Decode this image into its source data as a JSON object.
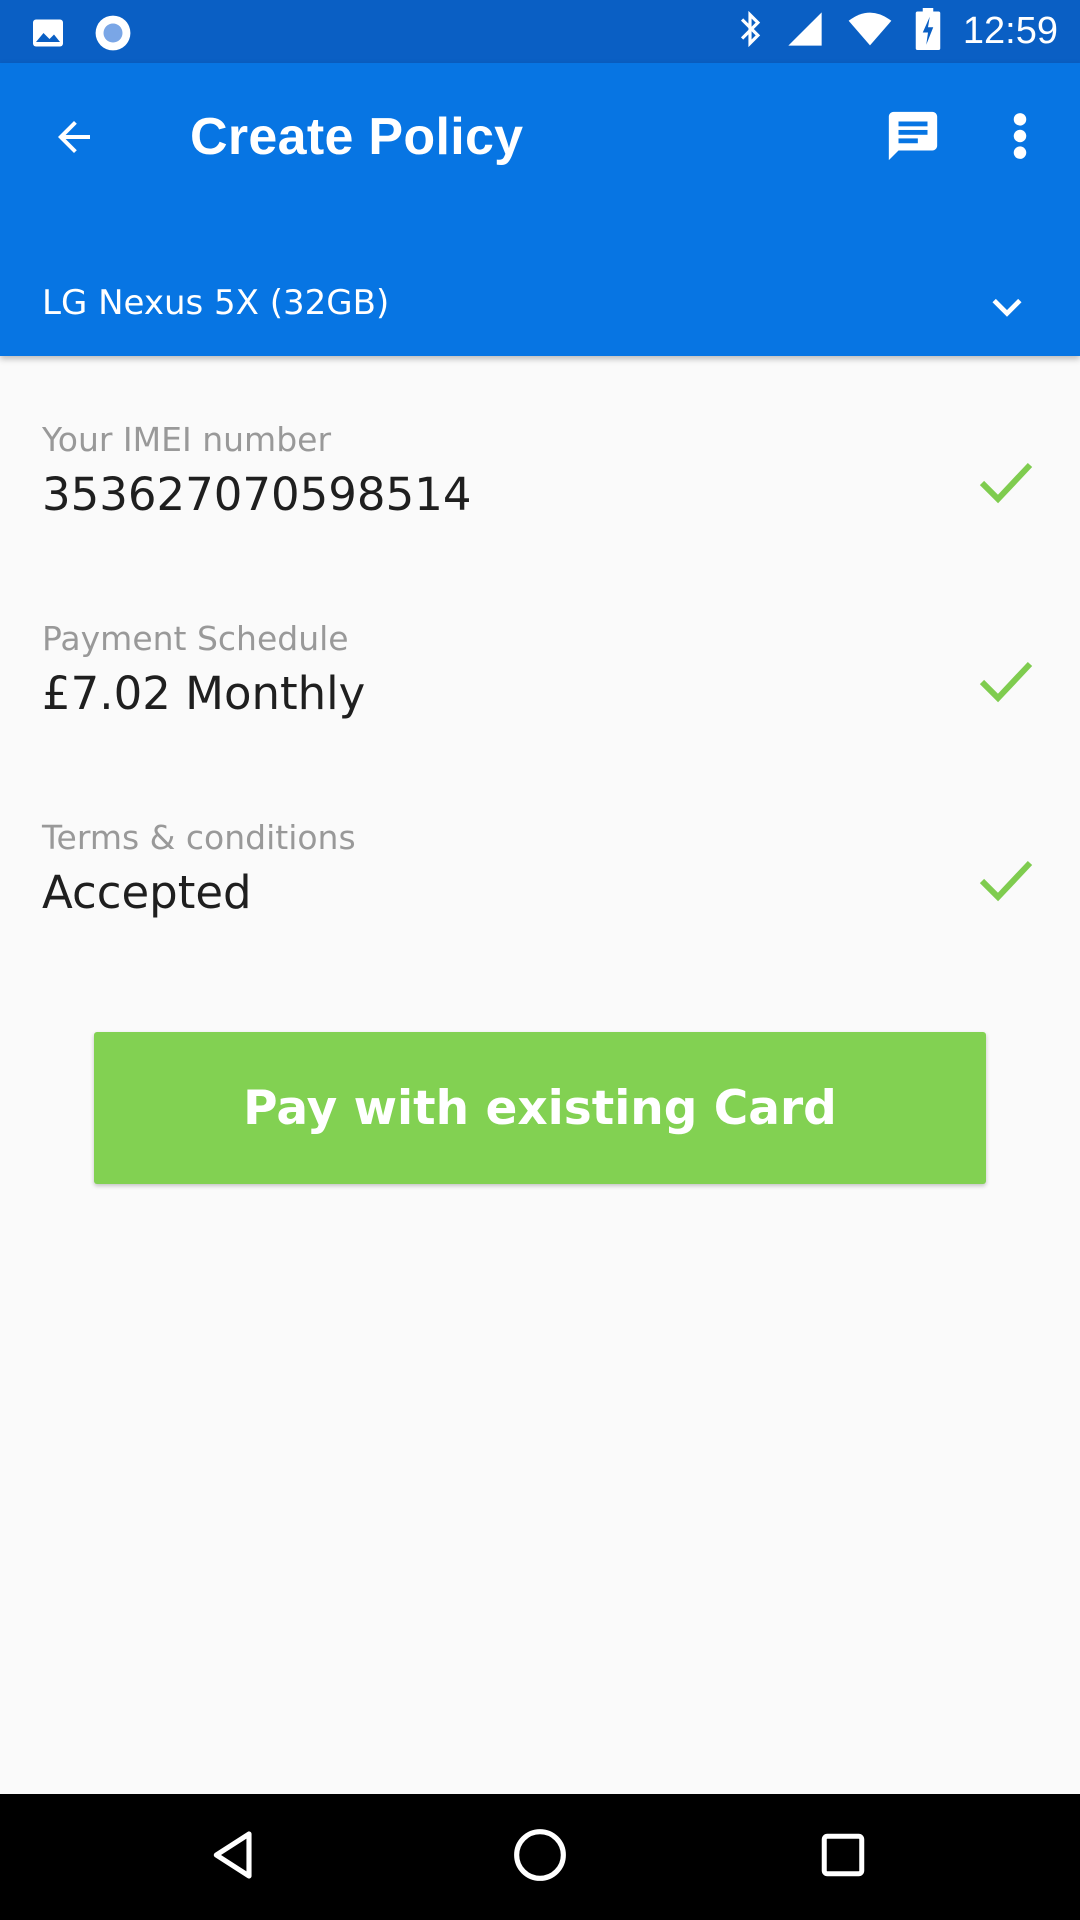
{
  "status_bar": {
    "time": "12:59",
    "left_icons": [
      "image-icon",
      "record-icon"
    ],
    "right_icons": [
      "bluetooth-icon",
      "signal-icon",
      "wifi-icon",
      "battery-charging-icon"
    ],
    "background": "#0a5fc4"
  },
  "app_bar": {
    "title": "Create Policy",
    "back_icon": "arrow-back-icon",
    "chat_icon": "chat-icon",
    "more_icon": "more-vert-icon",
    "background": "#0775e3"
  },
  "device_selector": {
    "value": "LG Nexus 5X (32GB)",
    "icon": "chevron-down-icon"
  },
  "fields": [
    {
      "label": "Your IMEI number",
      "value": "353627070598514",
      "status_icon": "check-icon"
    },
    {
      "label": "Payment Schedule",
      "value": "£7.02 Monthly",
      "status_icon": "check-icon"
    },
    {
      "label": "Terms & conditions",
      "value": "Accepted",
      "status_icon": "check-icon"
    }
  ],
  "pay_button": {
    "label": "Pay with existing Card",
    "color": "#82d152"
  },
  "nav_bar": {
    "buttons": [
      "back-triangle-icon",
      "home-circle-icon",
      "recents-square-icon"
    ]
  },
  "colors": {
    "check": "#7fcc4f",
    "label": "#999999",
    "value": "#1f1f1f"
  }
}
